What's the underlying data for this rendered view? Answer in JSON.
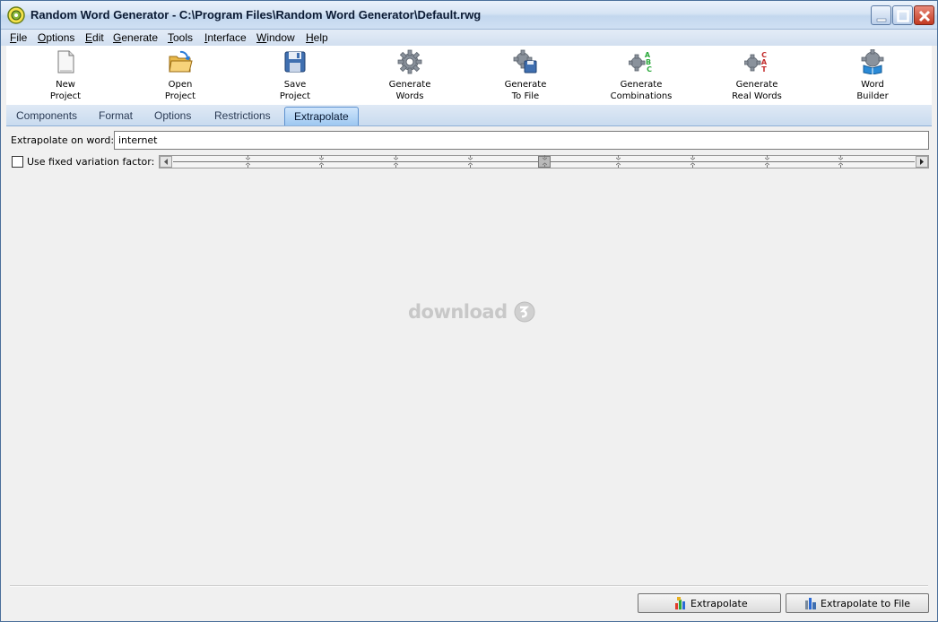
{
  "window": {
    "title": "Random Word Generator - C:\\Program Files\\Random Word Generator\\Default.rwg"
  },
  "menu": [
    {
      "u": "F",
      "rest": "ile"
    },
    {
      "u": "O",
      "rest": "ptions"
    },
    {
      "u": "E",
      "rest": "dit"
    },
    {
      "u": "G",
      "rest": "enerate"
    },
    {
      "u": "T",
      "rest": "ools"
    },
    {
      "u": "I",
      "rest": "nterface"
    },
    {
      "u": "W",
      "rest": "indow"
    },
    {
      "u": "H",
      "rest": "elp"
    }
  ],
  "toolbar": [
    {
      "label": "New\nProject",
      "icon": "new-document-icon"
    },
    {
      "label": "Open\nProject",
      "icon": "open-folder-icon"
    },
    {
      "label": "Save\nProject",
      "icon": "floppy-disk-icon"
    },
    {
      "label": "Generate\nWords",
      "icon": "gear-icon"
    },
    {
      "label": "Generate\nTo File",
      "icon": "gear-file-icon"
    },
    {
      "label": "Generate\nCombinations",
      "icon": "gear-abc-icon"
    },
    {
      "label": "Generate\nReal Words",
      "icon": "gear-cat-icon"
    },
    {
      "label": "Word\nBuilder",
      "icon": "gear-book-icon"
    }
  ],
  "tabs": [
    {
      "label": "Components",
      "active": false
    },
    {
      "label": "Format",
      "active": false
    },
    {
      "label": "Options",
      "active": false
    },
    {
      "label": "Restrictions",
      "active": false
    },
    {
      "label": "Extrapolate",
      "active": true
    }
  ],
  "extrapolate": {
    "word_label": "Extrapolate on word:",
    "word_value": "internet",
    "fixed_label": "Use fixed variation factor:",
    "fixed_checked": false,
    "slider_ticks": 11,
    "slider_position": 0.5
  },
  "watermark": "download",
  "buttons": {
    "extrapolate": "Extrapolate",
    "extrapolate_file": "Extrapolate to File"
  },
  "colors": {
    "active_tab": "#9ec8f1",
    "close_button": "#c23a22"
  }
}
